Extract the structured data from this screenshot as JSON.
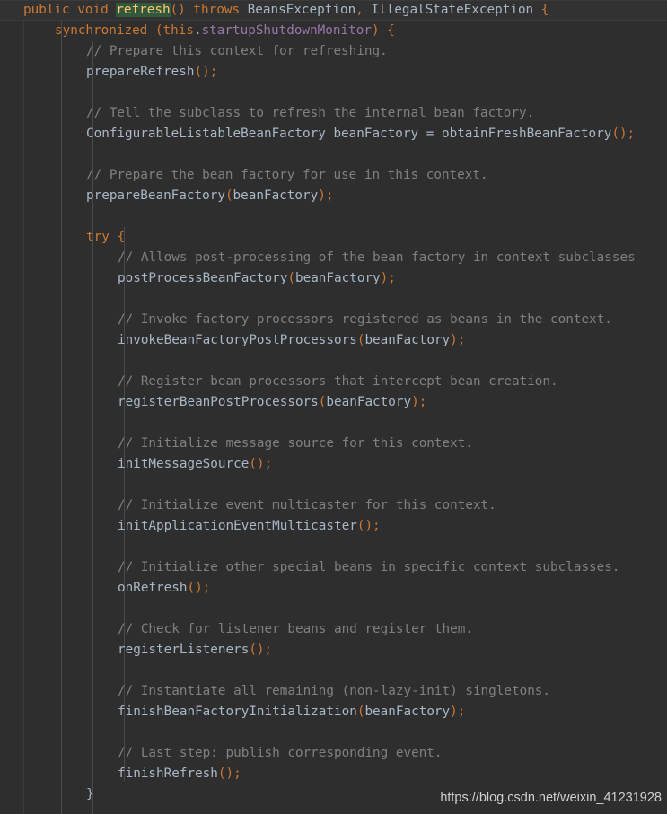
{
  "editor": {
    "language": "java",
    "theme": "darcula",
    "colors": {
      "background": "#2e2e2e",
      "current_line": "#323232",
      "default_text": "#a9b7c6",
      "keyword": "#cc7832",
      "comment": "#808080",
      "field": "#9876aa",
      "method_name": "#ffc66d",
      "selection": "#32593d",
      "indent_guide": "#4a4a4a"
    }
  },
  "code": {
    "lines": [
      {
        "indent": 0,
        "tokens": [
          {
            "t": "public",
            "c": "kw"
          },
          {
            "t": " ",
            "c": "id"
          },
          {
            "t": "void",
            "c": "kw"
          },
          {
            "t": " ",
            "c": "id"
          },
          {
            "t": "refresh",
            "c": "sel"
          },
          {
            "t": "()",
            "c": "punc"
          },
          {
            "t": " ",
            "c": "id"
          },
          {
            "t": "throws",
            "c": "kw"
          },
          {
            "t": " ",
            "c": "id"
          },
          {
            "t": "BeansException",
            "c": "cls"
          },
          {
            "t": ",",
            "c": "punc"
          },
          {
            "t": " ",
            "c": "id"
          },
          {
            "t": "IllegalStateException",
            "c": "cls"
          },
          {
            "t": " ",
            "c": "id"
          },
          {
            "t": "{",
            "c": "punc"
          }
        ]
      },
      {
        "indent": 1,
        "tokens": [
          {
            "t": "synchronized",
            "c": "kw"
          },
          {
            "t": " ",
            "c": "id"
          },
          {
            "t": "(",
            "c": "punc"
          },
          {
            "t": "this",
            "c": "kw"
          },
          {
            "t": ".",
            "c": "id"
          },
          {
            "t": "startupShutdownMonitor",
            "c": "fld"
          },
          {
            "t": ")",
            "c": "punc"
          },
          {
            "t": " ",
            "c": "id"
          },
          {
            "t": "{",
            "c": "punc"
          }
        ]
      },
      {
        "indent": 2,
        "tokens": [
          {
            "t": "// Prepare this context for refreshing.",
            "c": "cmt"
          }
        ]
      },
      {
        "indent": 2,
        "tokens": [
          {
            "t": "prepareRefresh",
            "c": "id"
          },
          {
            "t": "();",
            "c": "punc"
          }
        ]
      },
      {
        "indent": 2,
        "tokens": []
      },
      {
        "indent": 2,
        "tokens": [
          {
            "t": "// Tell the subclass to refresh the internal bean factory.",
            "c": "cmt"
          }
        ]
      },
      {
        "indent": 2,
        "tokens": [
          {
            "t": "ConfigurableListableBeanFactory",
            "c": "cls"
          },
          {
            "t": " beanFactory ",
            "c": "id"
          },
          {
            "t": "=",
            "c": "id"
          },
          {
            "t": " obtainFreshBeanFactory",
            "c": "id"
          },
          {
            "t": "();",
            "c": "punc"
          }
        ]
      },
      {
        "indent": 2,
        "tokens": []
      },
      {
        "indent": 2,
        "tokens": [
          {
            "t": "// Prepare the bean factory for use in this context.",
            "c": "cmt"
          }
        ]
      },
      {
        "indent": 2,
        "tokens": [
          {
            "t": "prepareBeanFactory",
            "c": "id"
          },
          {
            "t": "(",
            "c": "punc"
          },
          {
            "t": "beanFactory",
            "c": "id"
          },
          {
            "t": ");",
            "c": "punc"
          }
        ]
      },
      {
        "indent": 2,
        "tokens": []
      },
      {
        "indent": 2,
        "tokens": [
          {
            "t": "try",
            "c": "kw"
          },
          {
            "t": " ",
            "c": "id"
          },
          {
            "t": "{",
            "c": "punc"
          }
        ]
      },
      {
        "indent": 3,
        "tokens": [
          {
            "t": "// Allows post-processing of the bean factory in context subclasses",
            "c": "cmt"
          }
        ]
      },
      {
        "indent": 3,
        "tokens": [
          {
            "t": "postProcessBeanFactory",
            "c": "id"
          },
          {
            "t": "(",
            "c": "punc"
          },
          {
            "t": "beanFactory",
            "c": "id"
          },
          {
            "t": ");",
            "c": "punc"
          }
        ]
      },
      {
        "indent": 3,
        "tokens": []
      },
      {
        "indent": 3,
        "tokens": [
          {
            "t": "// Invoke factory processors registered as beans in the context.",
            "c": "cmt"
          }
        ]
      },
      {
        "indent": 3,
        "tokens": [
          {
            "t": "invokeBeanFactoryPostProcessors",
            "c": "id"
          },
          {
            "t": "(",
            "c": "punc"
          },
          {
            "t": "beanFactory",
            "c": "id"
          },
          {
            "t": ");",
            "c": "punc"
          }
        ]
      },
      {
        "indent": 3,
        "tokens": []
      },
      {
        "indent": 3,
        "tokens": [
          {
            "t": "// Register bean processors that intercept bean creation.",
            "c": "cmt"
          }
        ]
      },
      {
        "indent": 3,
        "tokens": [
          {
            "t": "registerBeanPostProcessors",
            "c": "id"
          },
          {
            "t": "(",
            "c": "punc"
          },
          {
            "t": "beanFactory",
            "c": "id"
          },
          {
            "t": ");",
            "c": "punc"
          }
        ]
      },
      {
        "indent": 3,
        "tokens": []
      },
      {
        "indent": 3,
        "tokens": [
          {
            "t": "// Initialize message source for this context.",
            "c": "cmt"
          }
        ]
      },
      {
        "indent": 3,
        "tokens": [
          {
            "t": "initMessageSource",
            "c": "id"
          },
          {
            "t": "();",
            "c": "punc"
          }
        ]
      },
      {
        "indent": 3,
        "tokens": []
      },
      {
        "indent": 3,
        "tokens": [
          {
            "t": "// Initialize event multicaster for this context.",
            "c": "cmt"
          }
        ]
      },
      {
        "indent": 3,
        "tokens": [
          {
            "t": "initApplicationEventMulticaster",
            "c": "id"
          },
          {
            "t": "();",
            "c": "punc"
          }
        ]
      },
      {
        "indent": 3,
        "tokens": []
      },
      {
        "indent": 3,
        "tokens": [
          {
            "t": "// Initialize other special beans in specific context subclasses.",
            "c": "cmt"
          }
        ]
      },
      {
        "indent": 3,
        "tokens": [
          {
            "t": "onRefresh",
            "c": "id"
          },
          {
            "t": "();",
            "c": "punc"
          }
        ]
      },
      {
        "indent": 3,
        "tokens": []
      },
      {
        "indent": 3,
        "tokens": [
          {
            "t": "// Check for listener beans and register them.",
            "c": "cmt"
          }
        ]
      },
      {
        "indent": 3,
        "tokens": [
          {
            "t": "registerListeners",
            "c": "id"
          },
          {
            "t": "();",
            "c": "punc"
          }
        ]
      },
      {
        "indent": 3,
        "tokens": []
      },
      {
        "indent": 3,
        "tokens": [
          {
            "t": "// Instantiate all remaining (non-lazy-init) singletons.",
            "c": "cmt"
          }
        ]
      },
      {
        "indent": 3,
        "tokens": [
          {
            "t": "finishBeanFactoryInitialization",
            "c": "id"
          },
          {
            "t": "(",
            "c": "punc"
          },
          {
            "t": "beanFactory",
            "c": "id"
          },
          {
            "t": ");",
            "c": "punc"
          }
        ]
      },
      {
        "indent": 3,
        "tokens": []
      },
      {
        "indent": 3,
        "tokens": [
          {
            "t": "// Last step: publish corresponding event.",
            "c": "cmt"
          }
        ]
      },
      {
        "indent": 3,
        "tokens": [
          {
            "t": "finishRefresh",
            "c": "id"
          },
          {
            "t": "();",
            "c": "punc"
          }
        ]
      },
      {
        "indent": 2,
        "tokens": [
          {
            "t": "}",
            "c": "brc"
          }
        ]
      }
    ]
  },
  "watermark": {
    "text": "https://blog.csdn.net/weixin_41231928"
  }
}
